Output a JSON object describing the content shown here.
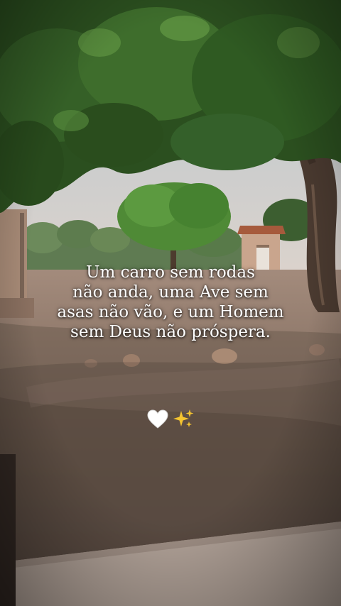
{
  "quote": {
    "lines": [
      "Um carro sem rodas",
      "não anda, uma Ave sem",
      "asas não vão, e um Homem",
      "sem Deus não próspera."
    ]
  },
  "emojis": [
    "white-heart",
    "sparkles"
  ],
  "colors": {
    "sky": "#c7d3da",
    "foliage": "#2f5a22",
    "ground": "#7d6a5e",
    "text": "#ffffff",
    "sparkle": "#f4c430"
  }
}
